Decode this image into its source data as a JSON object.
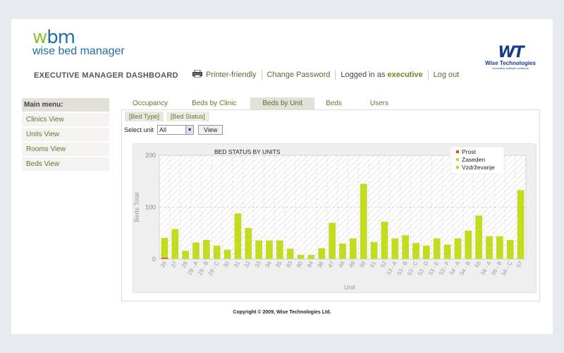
{
  "brand": {
    "logo_mark_w": "w",
    "logo_mark_bm": "bm",
    "logo_text": "wise bed manager"
  },
  "vendor": {
    "mark": "WT",
    "name": "Wise Technologies",
    "tagline": "Innovative software solutions"
  },
  "header": {
    "title": "EXECUTIVE MANAGER DASHBOARD"
  },
  "topnav": {
    "printer": "Printer-friendly",
    "change_password": "Change Password",
    "logged_in_prefix": "Logged in as",
    "user": "executive",
    "logout": "Log out"
  },
  "sidebar": {
    "heading": "Main menu:",
    "items": [
      {
        "label": "Clinics View"
      },
      {
        "label": "Units View"
      },
      {
        "label": "Rooms View"
      },
      {
        "label": "Beds View"
      }
    ]
  },
  "tabs": [
    {
      "label": "Occupancy"
    },
    {
      "label": "Beds by Clinic"
    },
    {
      "label": "Beds by Unit"
    },
    {
      "label": "Beds"
    },
    {
      "label": "Users"
    }
  ],
  "subtabs": [
    {
      "label": "[Bed Type]"
    },
    {
      "label": "[Bed Status]"
    }
  ],
  "select": {
    "label": "Select unit",
    "value": "All",
    "button": "View"
  },
  "footer": {
    "copyright": "Copyright © 2009, Wise Technologies Ltd."
  },
  "colors": {
    "prost": "#e0501e",
    "zaseden": "#c3dc21",
    "vzdrzevanje": "#a8e02a",
    "accent": "#5c7a2b"
  },
  "chart_data": {
    "type": "bar",
    "title": "BED STATUS BY UNITS",
    "xlabel": "Unit",
    "ylabel": "Beds Total",
    "ylim": [
      0,
      200
    ],
    "yticks": [
      0,
      100,
      200
    ],
    "grid": true,
    "legend_position": "top-right",
    "categories": [
      "26",
      "27",
      "28",
      "29 - A",
      "29 - B",
      "29 - C",
      "30",
      "31",
      "32",
      "33",
      "34",
      "35",
      "93",
      "90",
      "94",
      "96",
      "47",
      "48",
      "49",
      "50",
      "51",
      "52",
      "53 - A",
      "53 - B",
      "53 - C",
      "53 - D",
      "53 - E",
      "53 - F",
      "54 - A",
      "54 - B",
      "55",
      "56 - A",
      "56 - B",
      "56 - C",
      "57"
    ],
    "series": [
      {
        "name": "Prost",
        "values": [
          3,
          0,
          0,
          0,
          0,
          0,
          0,
          0,
          0,
          0,
          0,
          0,
          0,
          0,
          0,
          0,
          0,
          0,
          0,
          0,
          0,
          0,
          0,
          0,
          0,
          0,
          0,
          0,
          0,
          0,
          0,
          0,
          0,
          0,
          0
        ]
      },
      {
        "name": "Zaseden",
        "values": [
          38,
          58,
          16,
          32,
          37,
          26,
          18,
          88,
          60,
          36,
          36,
          36,
          20,
          8,
          8,
          21,
          70,
          30,
          40,
          145,
          33,
          72,
          40,
          46,
          31,
          26,
          40,
          28,
          40,
          55,
          84,
          44,
          44,
          37,
          133
        ]
      },
      {
        "name": "Vzdrževanje",
        "values": [
          0,
          0,
          0,
          0,
          0,
          0,
          0,
          0,
          0,
          0,
          0,
          0,
          0,
          0,
          0,
          0,
          0,
          0,
          0,
          0,
          0,
          0,
          0,
          0,
          0,
          0,
          0,
          0,
          0,
          0,
          0,
          0,
          0,
          0,
          0
        ]
      }
    ]
  }
}
